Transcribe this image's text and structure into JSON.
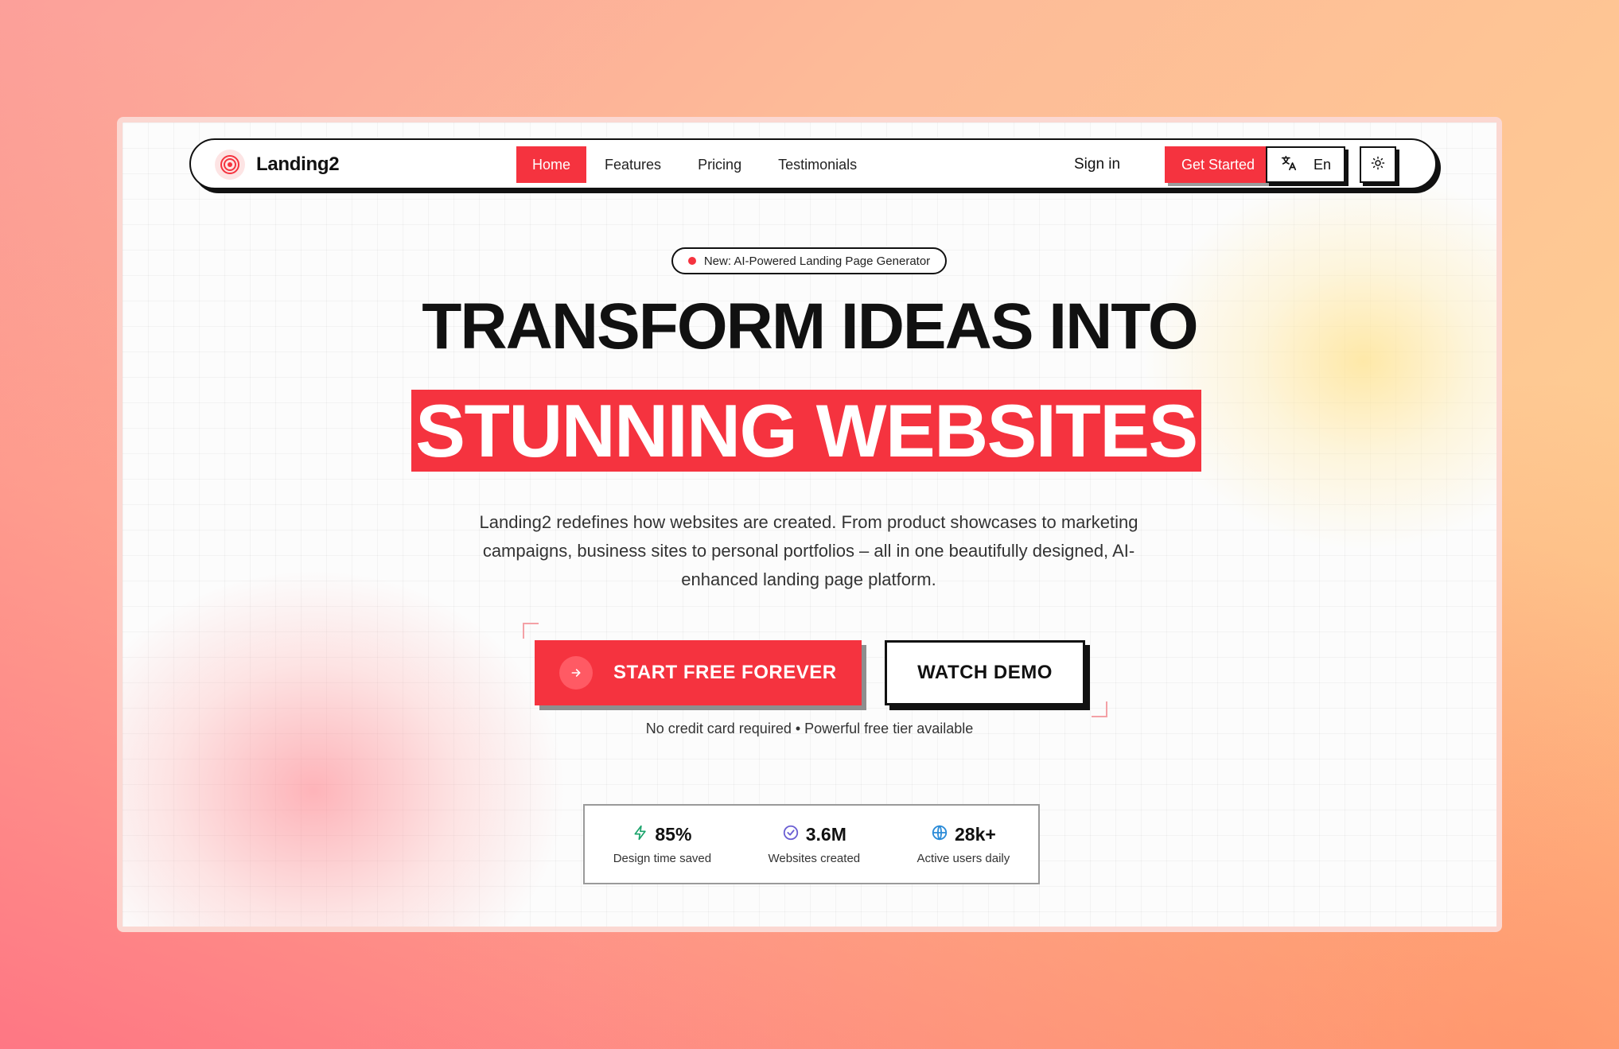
{
  "brand": {
    "name": "Landing2",
    "accent": "#f5333f"
  },
  "nav": {
    "links": [
      {
        "label": "Home",
        "active": true
      },
      {
        "label": "Features",
        "active": false
      },
      {
        "label": "Pricing",
        "active": false
      },
      {
        "label": "Testimonials",
        "active": false
      }
    ],
    "sign_in": "Sign in",
    "get_started": "Get Started",
    "language": "En",
    "language_icon": "translate-icon",
    "theme_icon": "sun-icon"
  },
  "hero": {
    "badge": "New: AI-Powered Landing Page Generator",
    "headline_line1": "TRANSFORM IDEAS INTO",
    "headline_line2": "STUNNING WEBSITES",
    "subtitle": "Landing2 redefines how websites are created. From product showcases to marketing campaigns, business sites to personal portfolios – all in one beautifully designed, AI-enhanced landing page platform.",
    "primary_cta": "START FREE FOREVER",
    "secondary_cta": "WATCH DEMO",
    "note": "No credit card required • Powerful free tier available"
  },
  "stats": [
    {
      "value": "85%",
      "label": "Design time saved",
      "icon": "lightning-icon",
      "icon_color": "#1aa36b"
    },
    {
      "value": "3.6M",
      "label": "Websites created",
      "icon": "check-circle-icon",
      "icon_color": "#6b5fd3"
    },
    {
      "value": "28k+",
      "label": "Active users daily",
      "icon": "globe-icon",
      "icon_color": "#2b8bd8"
    }
  ]
}
